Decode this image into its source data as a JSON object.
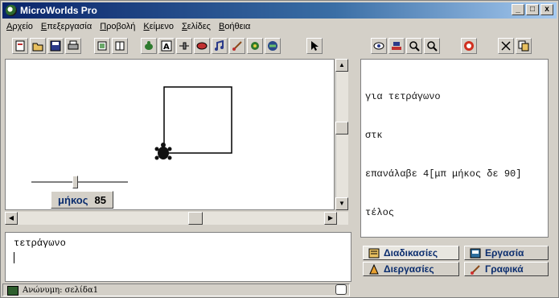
{
  "window": {
    "title": "MicroWorlds Pro",
    "minimize": "_",
    "maximize": "□",
    "close": "x"
  },
  "menu": [
    "Αρχείο",
    "Επεξεργασία",
    "Προβολή",
    "Κείμενο",
    "Σελίδες",
    "Βοήθεια"
  ],
  "page": {
    "slider": {
      "label": "μήκος",
      "value": "85",
      "fraction": 0.45
    }
  },
  "procedures": {
    "lines": [
      "για τετράγωνο",
      "στκ",
      "επανάλαβε 4[μπ μήκος δε 90]",
      "τέλος"
    ]
  },
  "command_center": {
    "text": "τετράγωνο"
  },
  "tabs": {
    "procedures": "Διαδικασίες",
    "project": "Εργασία",
    "processes": "Διεργασίες",
    "graphics": "Γραφικά"
  },
  "status": {
    "text": "Ανώνυμη: σελίδα1"
  },
  "icons": {
    "toolbar_left": [
      "new-page-icon",
      "open-folder-icon",
      "save-icon",
      "print-icon",
      "page-icon",
      "page-grid-icon",
      "turtle-icon",
      "text-box-icon",
      "slider-icon",
      "button-icon",
      "music-icon",
      "paint-icon",
      "melody-icon",
      "video-icon",
      "pointer-icon"
    ],
    "toolbar_right": [
      "eye-icon",
      "stamp-icon",
      "zoom-in-icon",
      "zoom-out-icon",
      "stop-icon",
      "scissors-icon",
      "copy-icon"
    ]
  },
  "colors": {
    "title_start": "#0a246a",
    "title_end": "#a6caf0",
    "tab_text": "#0b2d6e"
  }
}
